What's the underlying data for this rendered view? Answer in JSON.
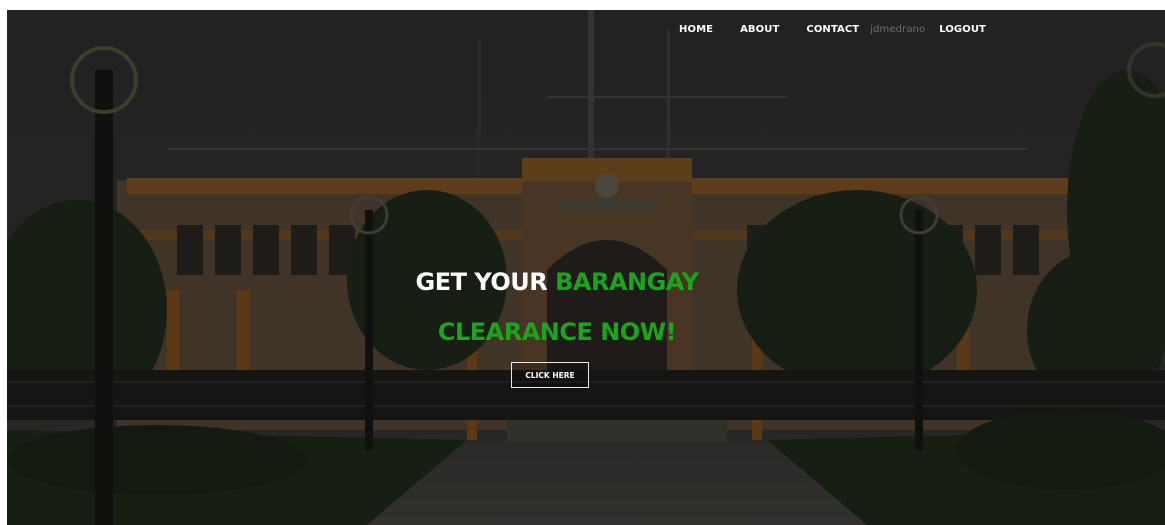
{
  "nav": {
    "home": "HOME",
    "about": "ABOUT",
    "contact": "CONTACT",
    "username": "jdmedrano",
    "logout": "LOGOUT"
  },
  "hero": {
    "line1_white": "GET YOUR ",
    "line1_green": "BARANGAY",
    "line2_green": "CLEARANCE NOW!",
    "button_label": "CLICK HERE"
  },
  "colors": {
    "accent_green": "#1aa51a",
    "nav_text": "#ffffff",
    "username_text": "#6e6e6e"
  }
}
